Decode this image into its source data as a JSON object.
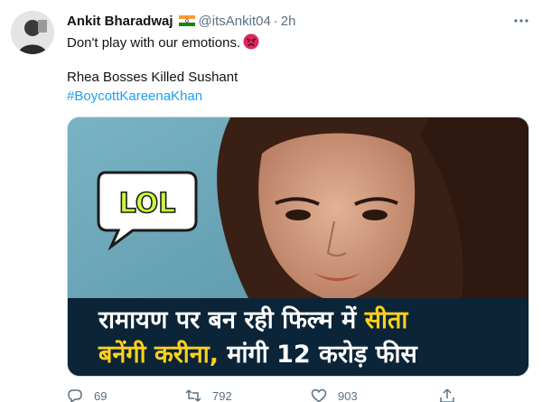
{
  "tweet": {
    "author_name": "Ankit Bharadwaj",
    "flag_icon": "india-flag-icon",
    "handle": "@itsAnkit04",
    "separator": "·",
    "time": "2h",
    "text_line_1": "Don't play with our emotions.",
    "text_line_2": "Rhea Bosses Killed Sushant",
    "hashtag": "#BoycottKareenaKhan",
    "colors": {
      "link": "#1da1f2",
      "muted": "#5b7083",
      "caption_bg": "#0b2437",
      "caption_highlight": "#ffd11a"
    }
  },
  "media": {
    "bubble_text": "LOL",
    "caption_line_1_white": "रामायण पर बन रही फिल्म में ",
    "caption_line_1_yellow": "सीता",
    "caption_line_2_yellow": "बनेंगी करीना, ",
    "caption_line_2_white": "मांगी 12 करोड़ फीस"
  },
  "actions": {
    "reply_count": "69",
    "retweet_count": "792",
    "like_count": "903"
  }
}
